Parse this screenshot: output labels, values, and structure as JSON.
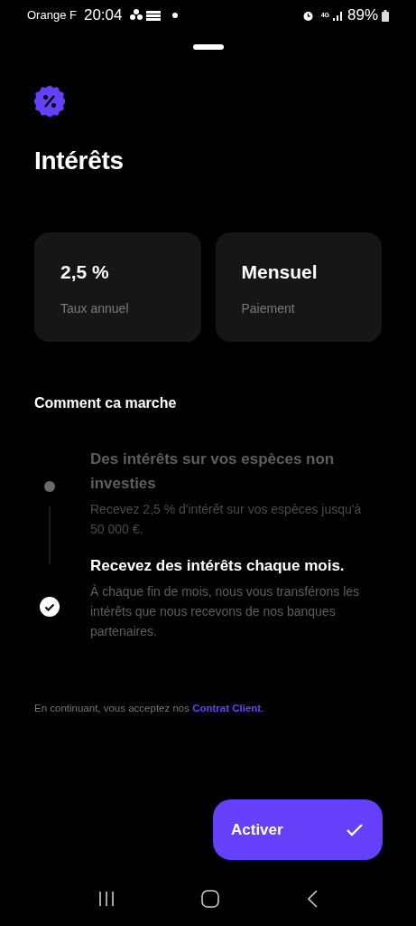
{
  "status_bar": {
    "carrier": "Orange F",
    "time": "20:04",
    "network": "4G",
    "battery": "89%"
  },
  "title": "Intérêts",
  "stats": [
    {
      "value": "2,5 %",
      "label": "Taux annuel"
    },
    {
      "value": "Mensuel",
      "label": "Paiement"
    }
  ],
  "section_title": "Comment ca marche",
  "steps": [
    {
      "title": "Des intérêts sur vos espèces non investies",
      "text": "Recevez 2,5 % d'intérêt sur vos espèces jusqu'à 50 000 €.",
      "current": false
    },
    {
      "title": "Recevez des intérêts chaque mois.",
      "text": "À chaque fin de mois, nous vous transférons les intérêts que nous recevons de nos banques partenaires.",
      "current": true
    }
  ],
  "legal": {
    "text": "En continuant, vous acceptez nos",
    "link": "Contrat Client",
    "end": "."
  },
  "button": {
    "label": "Activer"
  }
}
